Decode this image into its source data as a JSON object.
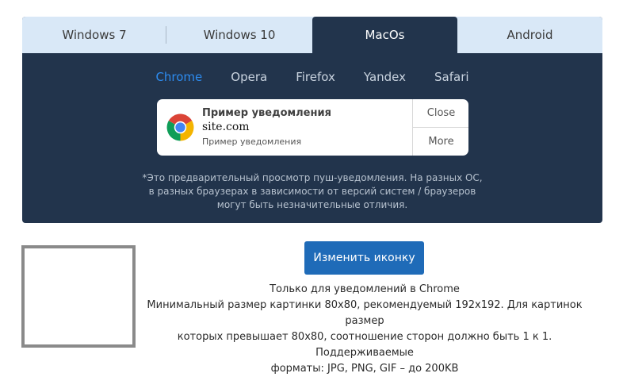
{
  "os_tabs": [
    "Windows 7",
    "Windows 10",
    "MacOs",
    "Android"
  ],
  "active_os": "MacOs",
  "browser_tabs": [
    "Chrome",
    "Opera",
    "Firefox",
    "Yandex",
    "Safari"
  ],
  "active_browser": "Chrome",
  "notification": {
    "icon": "chrome-logo-icon",
    "title": "Пример уведомления",
    "site": "site.com",
    "body": "Пример уведомления",
    "close_label": "Close",
    "more_label": "More"
  },
  "disclaimer": [
    "*Это предварительный просмотр пуш-уведомления. На разных ОС,",
    "в разных браузерах в зависимости от версий систем / браузеров",
    "могут быть незначительные отличия."
  ],
  "change_icon_button": "Изменить иконку",
  "requirements": [
    "Только для уведомлений в Chrome",
    "Минимальный размер картинки 80x80, рекомендуемый 192x192. Для картинок размер",
    "которых превышает 80x80, соотношение сторон должно быть 1 к 1. Поддерживаемые",
    "форматы: JPG, PNG, GIF – до 200KB"
  ],
  "colors": {
    "panel": "#22344c",
    "tab_bar": "#d9e8f7",
    "accent": "#2d8cf0",
    "button": "#1f6bb8"
  }
}
